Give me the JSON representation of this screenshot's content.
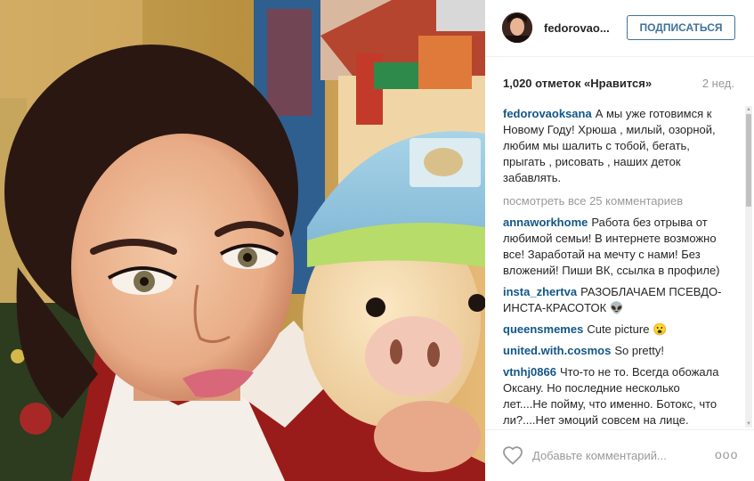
{
  "post": {
    "photo_icon": "photo",
    "header": {
      "username": "fedorovao...",
      "follow_label": "ПОДПИСАТЬСЯ"
    },
    "likes": "1,020 отметок «Нравится»",
    "time": "2 нед.",
    "caption": {
      "author": "fedorovaoksana",
      "text": "А мы уже готовимся к Новому Году! Хрюша , милый, озорной, любим мы шалить с тобой, бегать, прыгать , рисовать , наших деток забавлять."
    },
    "view_all": "посмотреть все 25 комментариев",
    "comments": [
      {
        "author": "annaworkhome",
        "text": "Работа без отрыва от любимой семьи! В интернете возможно все! Заработай на мечту с нами! Без вложений! Пиши ВК, ссылка в профиле)"
      },
      {
        "author": "insta_zhertva",
        "text": "РАЗОБЛАЧАЕМ ПСЕВДО-ИНСТА-КРАСОТОК 👽"
      },
      {
        "author": "queensmemes",
        "text": "Cute picture 😮"
      },
      {
        "author": "united.with.cosmos",
        "text": "So pretty!"
      },
      {
        "author": "vtnhj0866",
        "text": "Что-то не то. Всегда обожала Оксану. Но последние несколько лет....Не пойму, что именно. Ботокс, что ли?....Нет эмоций совсем на лице. Всегда одно и то же"
      }
    ],
    "comment_placeholder": "Добавьте комментарий...",
    "more_label": "ооо",
    "colors": {
      "link": "#125688",
      "follow": "#3f729b",
      "muted": "#999999"
    }
  }
}
